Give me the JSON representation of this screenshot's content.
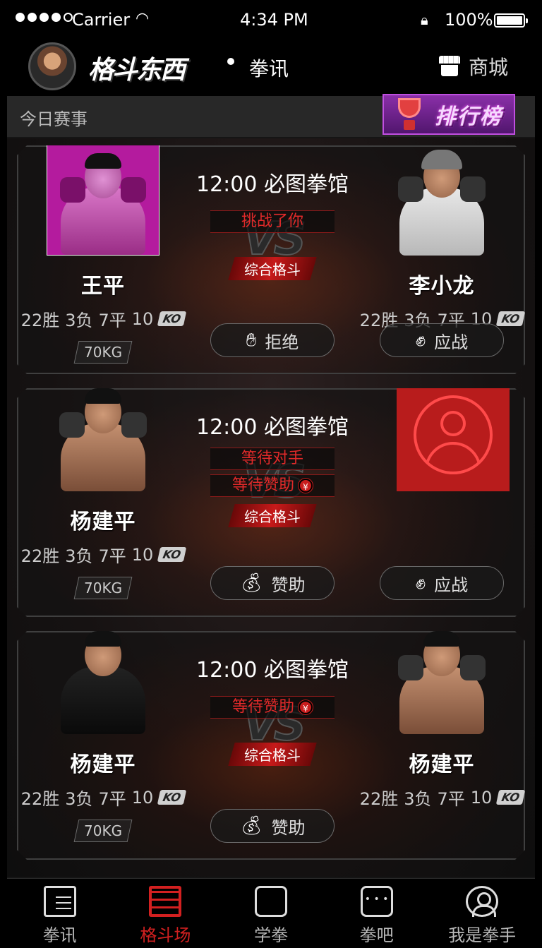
{
  "status_bar": {
    "carrier": "Carrier",
    "time": "4:34 PM",
    "battery": "100%"
  },
  "header": {
    "logo": "格斗东西",
    "subtitle": "拳讯",
    "shop_label": "商城"
  },
  "today": {
    "label": "今日赛事"
  },
  "ranking": {
    "label": "排行榜"
  },
  "matches": [
    {
      "title": "12:00  必图拳馆",
      "banners": [
        {
          "text": "挑战了你",
          "sponsor": false
        }
      ],
      "type": "综合格斗",
      "left": {
        "name": "王平",
        "wins": "22胜",
        "losses": "3负",
        "draws": "7平",
        "ko": "10",
        "ko_label": "KO",
        "weight": "70KG"
      },
      "right": {
        "name": "李小龙",
        "wins": "22胜",
        "losses": "3负",
        "draws": "7平",
        "ko": "10",
        "ko_label": "KO"
      },
      "actions": {
        "left": {
          "label": "拒绝",
          "icon": "hand-stop-icon"
        },
        "right": {
          "label": "应战",
          "icon": "fist-punch-icon"
        }
      }
    },
    {
      "title": "12:00  必图拳馆",
      "banners": [
        {
          "text": "等待对手",
          "sponsor": false
        },
        {
          "text": "等待赞助",
          "sponsor": true
        }
      ],
      "type": "综合格斗",
      "left": {
        "name": "杨建平",
        "wins": "22胜",
        "losses": "3负",
        "draws": "7平",
        "ko": "10",
        "ko_label": "KO",
        "weight": "70KG"
      },
      "actions": {
        "left": {
          "label": "赞助",
          "icon": "money-bag-icon"
        },
        "right": {
          "label": "应战",
          "icon": "fist-punch-icon"
        }
      }
    },
    {
      "title": "12:00  必图拳馆",
      "banners": [
        {
          "text": "等待赞助",
          "sponsor": true
        }
      ],
      "type": "综合格斗",
      "left": {
        "name": "杨建平",
        "wins": "22胜",
        "losses": "3负",
        "draws": "7平",
        "ko": "10",
        "ko_label": "KO",
        "weight": "70KG"
      },
      "right": {
        "name": "杨建平",
        "wins": "22胜",
        "losses": "3负",
        "draws": "7平",
        "ko": "10",
        "ko_label": "KO"
      },
      "actions": {
        "center": {
          "label": "赞助",
          "icon": "money-bag-icon"
        }
      }
    }
  ],
  "yen_symbol": "¥",
  "tabs": [
    {
      "label": "拳讯",
      "icon": "news-icon"
    },
    {
      "label": "格斗场",
      "icon": "boxing-ring-icon",
      "active": true
    },
    {
      "label": "学拳",
      "icon": "learn-boxing-icon"
    },
    {
      "label": "拳吧",
      "icon": "chat-icon"
    },
    {
      "label": "我是拳手",
      "icon": "profile-icon"
    }
  ],
  "colors": {
    "accent": "#d22020",
    "bar": "#282828",
    "ranking": "#7a2a9a"
  }
}
